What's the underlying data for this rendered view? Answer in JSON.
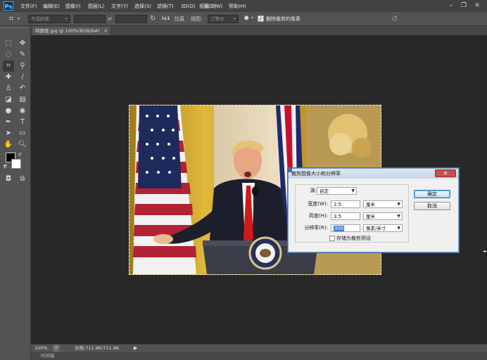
{
  "app": {
    "logo": "Ps"
  },
  "menu": [
    "文件(F)",
    "编辑(E)",
    "图像(I)",
    "图层(L)",
    "文字(Y)",
    "选择(S)",
    "滤镜(T)",
    "3D(D)",
    "视图(V)",
    "窗口(W)",
    "帮助(H)"
  ],
  "options": {
    "ratio_value": "不受约束",
    "swap_symbol": "⇄",
    "straighten_label": "拉直",
    "view_label": "视图:",
    "view_value": "三等分",
    "delete_cropped_label": "删除裁剪的像素",
    "delete_cropped_checked": true
  },
  "document": {
    "tab_label": "特朗普.jpg @ 100%(RGB/8#)",
    "tab_close": "×"
  },
  "status": {
    "zoom": "100%",
    "doc_info": "文档:711.9K/711.9K"
  },
  "timeline": {
    "label": "时间轴"
  },
  "dialog": {
    "title": "裁剪图像大小和分辨率",
    "close_symbol": "✕",
    "source_label": "源:",
    "source_value": "自定",
    "width_label": "宽度(W):",
    "width_value": "2.5",
    "width_unit": "厘米",
    "height_label": "高度(H):",
    "height_value": "3.5",
    "height_unit": "厘米",
    "resolution_label": "分辨率(R):",
    "resolution_value": "300",
    "resolution_unit": "像素/英寸",
    "save_preset_label": "存储为裁剪预设",
    "ok_label": "确定",
    "cancel_label": "取消"
  }
}
